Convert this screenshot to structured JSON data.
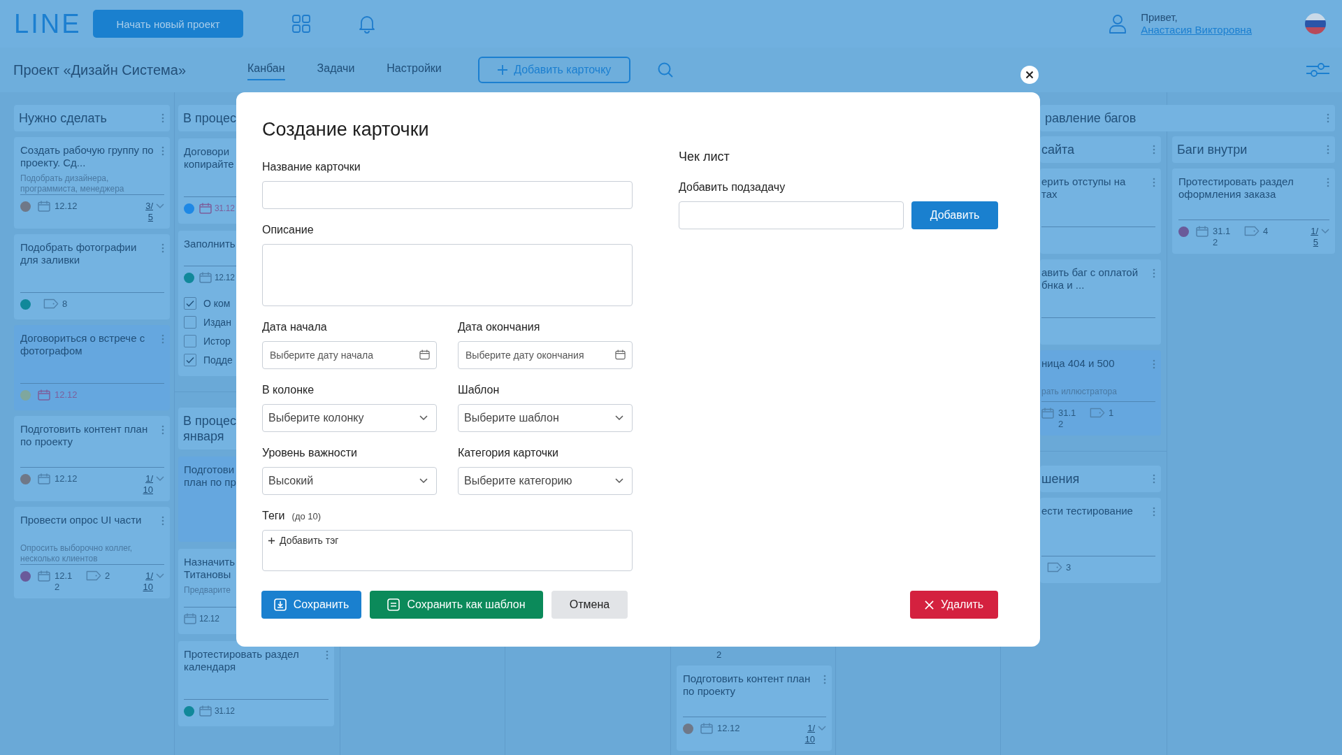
{
  "header": {
    "logo": "LINE",
    "new_project_button": "Начать новый проект",
    "greeting": "Привет,",
    "user_name": "Анастасия Викторовна"
  },
  "toolbar": {
    "project_title": "Проект «Дизайн Система»",
    "tabs": [
      {
        "label": "Канбан",
        "selected": true
      },
      {
        "label": "Задачи",
        "selected": false
      },
      {
        "label": "Настройки",
        "selected": false
      }
    ],
    "add_card_button": "Добавить карточку"
  },
  "board": {
    "columns": [
      {
        "items": [
          {
            "kind": "header",
            "title": "Нужно сделать",
            "menu": true
          },
          {
            "kind": "card",
            "title": "Создать рабочую группу по проекту. Сд...",
            "description": "Подобрать дизайнера, программиста, менеджера",
            "highlighted": false,
            "menu": true,
            "color": "#6f7888",
            "date": "12.12",
            "overdue": false,
            "progress": "3/5"
          },
          {
            "kind": "card",
            "title": "Подобрать фотографии для заливки",
            "highlighted": false,
            "menu": true,
            "color": "#11889a",
            "tags": "8"
          },
          {
            "kind": "card",
            "title": "Договориться о встрече с фотографом",
            "highlighted": true,
            "menu": true,
            "color": "#7fa79e",
            "date": "12.12",
            "overdue": true
          },
          {
            "kind": "card",
            "title": "Подготовить контент план по проекту",
            "highlighted": false,
            "menu": true,
            "color": "#6f7888",
            "date": "12.12",
            "overdue": false,
            "progress": "1/10"
          },
          {
            "kind": "card",
            "title": "Провести опрос UI части",
            "description": "Опросить выборочно коллег, несколько клиентов",
            "highlighted": false,
            "menu": true,
            "color": "#6a5a9a",
            "date": "12.12",
            "overdue": false,
            "tags": "2",
            "progress": "1/10"
          }
        ]
      },
      {
        "items": [
          {
            "kind": "header",
            "title": "В процес"
          },
          {
            "kind": "card",
            "title": "Договори\nкопирайте",
            "highlighted": false,
            "color": "#1e88e5",
            "date": "31.12",
            "overdue": true
          },
          {
            "kind": "card",
            "title": "Заполнить",
            "highlighted": false,
            "color": "#11889a",
            "date": "12.12",
            "overdue": false,
            "checklist": [
              {
                "label": "О ком",
                "checked": true
              },
              {
                "label": "Издан",
                "checked": false
              },
              {
                "label": "Истор",
                "checked": false
              },
              {
                "label": "Подде",
                "checked": true
              }
            ]
          },
          {
            "kind": "divider"
          },
          {
            "kind": "header",
            "title": "В процес\nянваря"
          },
          {
            "kind": "note",
            "title": "Подготови\nплан по пр",
            "highlighted": true
          },
          {
            "kind": "card",
            "title": "Назначить\nТитановы",
            "description": "Предварите",
            "highlighted": false,
            "date": "12.12",
            "overdue": false
          },
          {
            "kind": "card",
            "title": "Протестировать раздел календаря",
            "highlighted": false,
            "menu": true,
            "color": "#11889a",
            "date": "31.12",
            "overdue": false
          }
        ]
      },
      {
        "items": [
          {
            "kind": "text",
            "text": "2"
          },
          {
            "kind": "card",
            "title": "Подготовить контент план по проекту",
            "highlighted": false,
            "menu": true,
            "color": "#6f7888",
            "date": "12.12",
            "overdue": false,
            "progress": "1/10"
          }
        ]
      }
    ],
    "group": {
      "title": "равление багов",
      "menu": true,
      "columns": [
        {
          "items": [
            {
              "kind": "header",
              "title": "сайта",
              "menu": true
            },
            {
              "kind": "card",
              "title": "ерить отступы на\nтах",
              "highlighted": false,
              "menu": true
            },
            {
              "kind": "card",
              "title": "авить баг с оплатой\nбнка и ...",
              "highlighted": false,
              "menu": true
            },
            {
              "kind": "card",
              "title": "ница 404 и 500",
              "description": "рать иллюстратора",
              "highlighted": true,
              "menu": true,
              "date": "31.12",
              "overdue": false,
              "tags": "1"
            },
            {
              "kind": "divider"
            },
            {
              "kind": "header",
              "title": "шения",
              "menu": true
            },
            {
              "kind": "card",
              "title": "ести тестирование",
              "highlighted": false,
              "menu": true,
              "tags": "3"
            }
          ]
        },
        {
          "items": [
            {
              "kind": "header",
              "title": "Баги внутри",
              "menu": true
            },
            {
              "kind": "card",
              "title": "Протестировать раздел оформления заказа",
              "highlighted": false,
              "menu": true,
              "color": "#6a5a9a",
              "date": "31.12",
              "overdue": false,
              "tags": "4",
              "progress": "1/5"
            }
          ]
        }
      ]
    }
  },
  "modal": {
    "title": "Создание карточки",
    "fields": [
      {
        "kind": "text",
        "label": "Название карточки"
      },
      {
        "kind": "textarea",
        "label": "Описание"
      },
      {
        "kind": "date",
        "label": "Дата начала",
        "placeholder": "Выберите дату начала"
      },
      {
        "kind": "date",
        "label": "Дата окончания",
        "placeholder": "Выберите дату окончания"
      },
      {
        "kind": "select",
        "label": "В колонке",
        "placeholder": "Выберите колонку"
      },
      {
        "kind": "select",
        "label": "Шаблон",
        "placeholder": "Выберите шаблон"
      },
      {
        "kind": "select",
        "label": "Уровень важности",
        "value": "Высокий"
      },
      {
        "kind": "select",
        "label": "Категория карточки",
        "placeholder": "Выберите категорию"
      },
      {
        "kind": "tags",
        "label": "Теги",
        "hint": "(до 10)",
        "add": "Добавить тэг"
      }
    ],
    "checklist": {
      "title": "Чек лист",
      "label": "Добавить подзадачу",
      "button": "Добавить"
    },
    "buttons": [
      {
        "kind": "save",
        "label": "Сохранить"
      },
      {
        "kind": "template",
        "label": "Сохранить как шаблон"
      },
      {
        "kind": "cancel",
        "label": "Отмена"
      },
      {
        "kind": "delete",
        "label": "Удалить"
      }
    ]
  }
}
